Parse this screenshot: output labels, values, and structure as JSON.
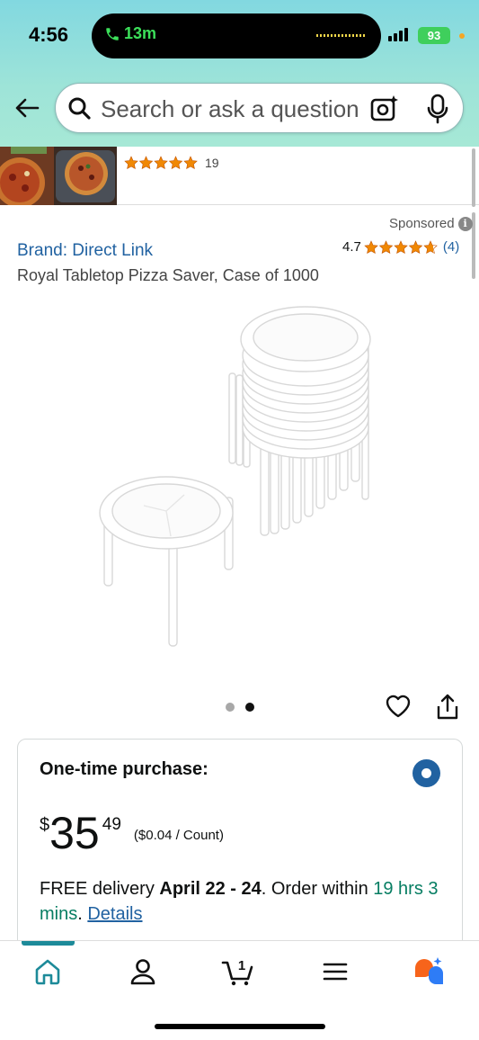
{
  "status_bar": {
    "time": "4:56",
    "call_duration": "13m",
    "battery": "93"
  },
  "search": {
    "placeholder": "Search or ask a question"
  },
  "prev_item": {
    "rating_count": "19"
  },
  "product": {
    "sponsored_label": "Sponsored",
    "brand": "Brand: Direct Link",
    "rating_value": "4.7",
    "rating_count": "(4)",
    "title": "Royal Tabletop Pizza Saver, Case of 1000",
    "image_count": 2,
    "active_image": 2
  },
  "purchase": {
    "title": "One-time purchase:",
    "price_symbol": "$",
    "price_whole": "35",
    "price_fraction": "49",
    "unit_price": "($0.04 / Count)",
    "delivery_prefix": "FREE delivery ",
    "delivery_dates": "April 22 - 24",
    "delivery_mid": ". Order within ",
    "delivery_time": "19 hrs 3 mins",
    "delivery_end": ". ",
    "details_link": "Details"
  },
  "nav": {
    "items": [
      {
        "name": "home",
        "icon": "home-icon"
      },
      {
        "name": "account",
        "icon": "person-icon"
      },
      {
        "name": "cart",
        "icon": "cart-icon",
        "count": "1"
      },
      {
        "name": "menu",
        "icon": "menu-icon"
      },
      {
        "name": "assistant",
        "icon": "chat-icon"
      }
    ]
  },
  "colors": {
    "link": "#2162a1",
    "star": "#f08804",
    "accent": "#1d8a99",
    "green_text": "#067d62"
  }
}
